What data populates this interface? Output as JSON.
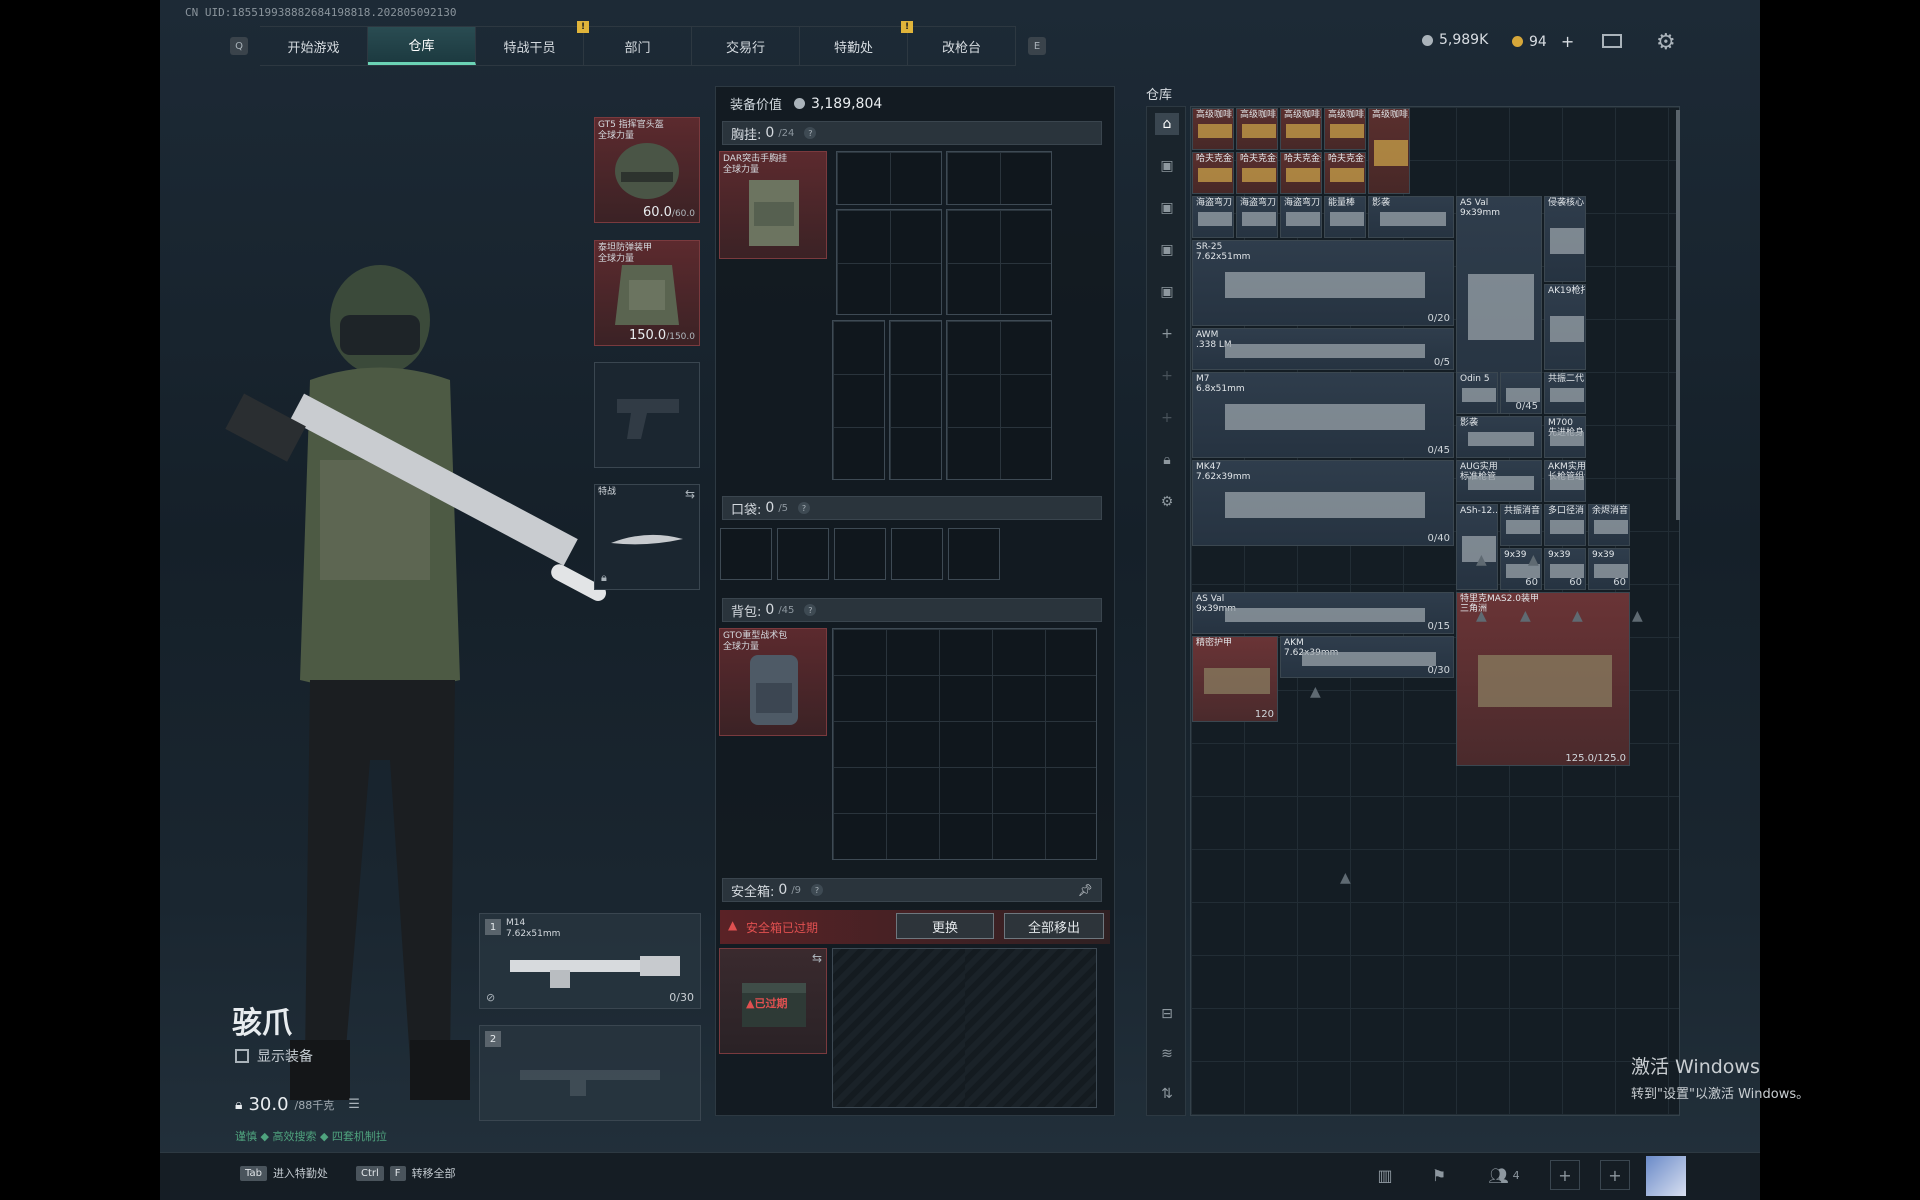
{
  "uid": "CN UID:185519938882684198818.202805092130",
  "nav": {
    "q_key": "Q",
    "e_key": "E",
    "tabs": [
      {
        "label": "开始游戏",
        "active": false,
        "alert": false
      },
      {
        "label": "仓库",
        "active": true,
        "alert": false
      },
      {
        "label": "特战干员",
        "active": false,
        "alert": true
      },
      {
        "label": "部门",
        "active": false,
        "alert": false
      },
      {
        "label": "交易行",
        "active": false,
        "alert": false
      },
      {
        "label": "特勤处",
        "active": false,
        "alert": true
      },
      {
        "label": "改枪台",
        "active": false,
        "alert": false
      }
    ],
    "alert_glyph": "!"
  },
  "currency": {
    "silver": "5,989K",
    "gold": "94",
    "plus": "+"
  },
  "character": {
    "name": "骇爪",
    "show_gear": "显示装备",
    "weight": "30.0",
    "weight_max": "/88千克",
    "tags": "谨慎  ◆ 高效搜索  ◆ 四套机制拉"
  },
  "gear": {
    "helmet": {
      "label": "GT5 指挥官头盔\n全球力量",
      "dur": "60.0",
      "max": "/60.0"
    },
    "armor": {
      "label": "泰坦防弹装甲\n全球力量",
      "dur": "150.0",
      "max": "/150.0"
    },
    "melee": {
      "label": "特战"
    },
    "weapon1": {
      "num": "1",
      "name": "M14",
      "ammo": "7.62x51mm",
      "count": "0/30"
    },
    "weapon2": {
      "num": "2"
    }
  },
  "middle": {
    "equip_value_label": "装备价值",
    "equip_value": "3,189,804",
    "chest": {
      "label": "胸挂:",
      "cur": "0",
      "max": "/24",
      "item": "DAR突击手胸挂\n全球力量"
    },
    "pocket": {
      "label": "口袋:",
      "cur": "0",
      "max": "/5"
    },
    "backpack": {
      "label": "背包:",
      "cur": "0",
      "max": "/45",
      "item": "GTO重型战术包\n全球力量"
    },
    "safe": {
      "label": "安全箱:",
      "cur": "0",
      "max": "/9",
      "expired": "安全箱已过期",
      "replace": "更换",
      "remove_all": "全部移出",
      "expired_tag": "已过期"
    }
  },
  "warehouse": {
    "title": "仓库",
    "items": [
      {
        "name": "高级咖啡豆",
        "color": "gold"
      },
      {
        "name": "高级咖啡豆",
        "color": "gold"
      },
      {
        "name": "高级咖啡豆",
        "color": "gold"
      },
      {
        "name": "高级咖啡豆",
        "color": "gold"
      },
      {
        "name": "高级咖啡豆",
        "color": "gold"
      },
      {
        "name": "哈夫克金条",
        "color": "gold"
      },
      {
        "name": "哈夫克金条",
        "color": "gold"
      },
      {
        "name": "哈夫克金条",
        "color": "gold"
      },
      {
        "name": "哈夫克金条",
        "color": "gold"
      },
      {
        "name": "海盗弯刀",
        "color": "blue"
      },
      {
        "name": "海盗弯刀",
        "color": "blue"
      },
      {
        "name": "海盗弯刀",
        "color": "blue"
      },
      {
        "name": "能量棒",
        "color": "blue"
      },
      {
        "name": "影袭",
        "color": "blue"
      },
      {
        "name": "AS Val\n9x39mm",
        "color": "blue"
      },
      {
        "name": "侵袭核心",
        "color": "blue"
      },
      {
        "name": "SR-25\n7.62x51mm",
        "count": "0/20",
        "color": "blue"
      },
      {
        "name": "AK19枪托",
        "color": "blue"
      },
      {
        "name": "AWM\n.338 LM",
        "count": "0/5",
        "color": "blue"
      },
      {
        "name": "M7\n6.8x51mm",
        "count": "0/45",
        "color": "blue"
      },
      {
        "name": "Odin 5",
        "color": "blue"
      },
      {
        "name": "",
        "count": "0/45",
        "color": "blue"
      },
      {
        "name": "共振二代",
        "color": "blue"
      },
      {
        "name": "影袭",
        "color": "blue"
      },
      {
        "name": "M700\n先进枪身",
        "color": "blue"
      },
      {
        "name": "MK47\n7.62x39mm",
        "count": "0/40",
        "color": "blue"
      },
      {
        "name": "AUG实用\n标准枪管",
        "color": "blue"
      },
      {
        "name": "AKM实用\n长枪管组合",
        "color": "blue"
      },
      {
        "name": "ASh-12...",
        "color": "blue"
      },
      {
        "name": "共振消音",
        "color": "blue"
      },
      {
        "name": "多口径消...",
        "color": "blue"
      },
      {
        "name": "余烬消音",
        "color": "blue"
      },
      {
        "name": "9x39",
        "count": "60",
        "color": "blue"
      },
      {
        "name": "9x39",
        "count": "60",
        "color": "blue"
      },
      {
        "name": "9x39",
        "count": "60",
        "color": "blue"
      },
      {
        "name": "AS Val\n9x39mm",
        "count": "0/15",
        "color": "blue"
      },
      {
        "name": "特里克MAS2.0装甲\n三角洲",
        "count": "125.0/125.0",
        "color": "red"
      },
      {
        "name": "精密护甲",
        "count": "120",
        "color": "red"
      },
      {
        "name": "AKM\n7.62x39mm",
        "count": "0/30",
        "color": "blue"
      }
    ]
  },
  "bottom": {
    "hint1_key": "Tab",
    "hint1": "进入特勤处",
    "hint2_key1": "Ctrl",
    "hint2_key2": "F",
    "hint2": "转移全部",
    "squad": "4"
  },
  "windows": {
    "line1": "激活 Windows",
    "line2": "转到\"设置\"以激活 Windows。"
  }
}
